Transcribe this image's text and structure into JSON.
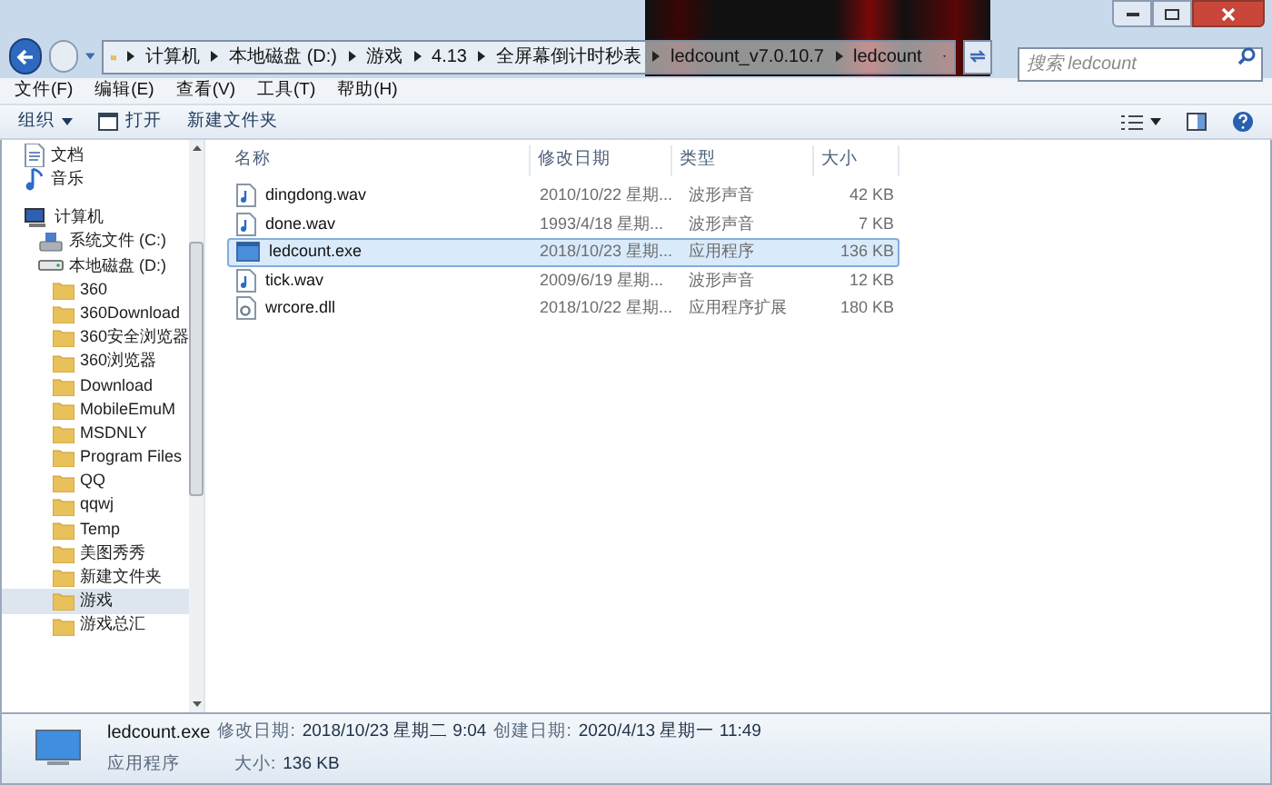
{
  "address_bar": {
    "crumbs": [
      "计算机",
      "本地磁盘 (D:)",
      "游戏",
      "4.13",
      "全屏幕倒计时秒表",
      "ledcount_v7.0.10.7",
      "ledcount"
    ]
  },
  "search": {
    "placeholder": "搜索 ledcount"
  },
  "menu": [
    "文件(F)",
    "编辑(E)",
    "查看(V)",
    "工具(T)",
    "帮助(H)"
  ],
  "toolbar": {
    "organize": "组织",
    "open": "打开",
    "new_folder": "新建文件夹"
  },
  "sidebar": {
    "items": [
      {
        "label": "文档",
        "kind": "doc",
        "selected": false
      },
      {
        "label": "音乐",
        "kind": "music",
        "selected": false
      },
      {
        "label": "计算机",
        "kind": "computer",
        "selected": false,
        "children": [
          {
            "label": "系统文件 (C:)",
            "kind": "drive",
            "selected": false
          },
          {
            "label": "本地磁盘 (D:)",
            "kind": "disk",
            "selected": false,
            "children": [
              {
                "label": "360",
                "kind": "folder",
                "selected": false
              },
              {
                "label": "360Download",
                "kind": "folder",
                "selected": false
              },
              {
                "label": "360安全浏览器",
                "kind": "folder",
                "selected": false
              },
              {
                "label": "360浏览器",
                "kind": "folder",
                "selected": false
              },
              {
                "label": "Download",
                "kind": "folder",
                "selected": false
              },
              {
                "label": "MobileEmuM",
                "kind": "folder",
                "selected": false
              },
              {
                "label": "MSDNLY",
                "kind": "folder",
                "selected": false
              },
              {
                "label": "Program Files",
                "kind": "folder",
                "selected": false
              },
              {
                "label": "QQ",
                "kind": "folder",
                "selected": false
              },
              {
                "label": "qqwj",
                "kind": "folder",
                "selected": false
              },
              {
                "label": "Temp",
                "kind": "folder",
                "selected": false
              },
              {
                "label": "美图秀秀",
                "kind": "folder",
                "selected": false
              },
              {
                "label": "新建文件夹",
                "kind": "folder",
                "selected": false
              },
              {
                "label": "游戏",
                "kind": "folder",
                "selected": true
              },
              {
                "label": "游戏总汇",
                "kind": "folder",
                "selected": false
              }
            ]
          }
        ]
      }
    ]
  },
  "table": {
    "columns": [
      "名称",
      "修改日期",
      "类型",
      "大小"
    ],
    "rows": [
      {
        "name": "dingdong.wav",
        "date": "2010/10/22 星期...",
        "type": "波形声音",
        "size": "42 KB",
        "kind": "audio",
        "selected": false
      },
      {
        "name": "done.wav",
        "date": "1993/4/18 星期...",
        "type": "波形声音",
        "size": "7 KB",
        "kind": "audio",
        "selected": false
      },
      {
        "name": "ledcount.exe",
        "date": "2018/10/23 星期...",
        "type": "应用程序",
        "size": "136 KB",
        "kind": "app",
        "selected": true
      },
      {
        "name": "tick.wav",
        "date": "2009/6/19 星期...",
        "type": "波形声音",
        "size": "12 KB",
        "kind": "audio",
        "selected": false
      },
      {
        "name": "wrcore.dll",
        "date": "2018/10/22 星期...",
        "type": "应用程序扩展",
        "size": "180 KB",
        "kind": "dll",
        "selected": false
      }
    ]
  },
  "details": {
    "name": "ledcount.exe",
    "modified_label": "修改日期:",
    "modified": "2018/10/23 星期二 9:04",
    "created_label": "创建日期:",
    "created": "2020/4/13 星期一 11:49",
    "type": "应用程序",
    "size_label": "大小:",
    "size": "136 KB"
  }
}
